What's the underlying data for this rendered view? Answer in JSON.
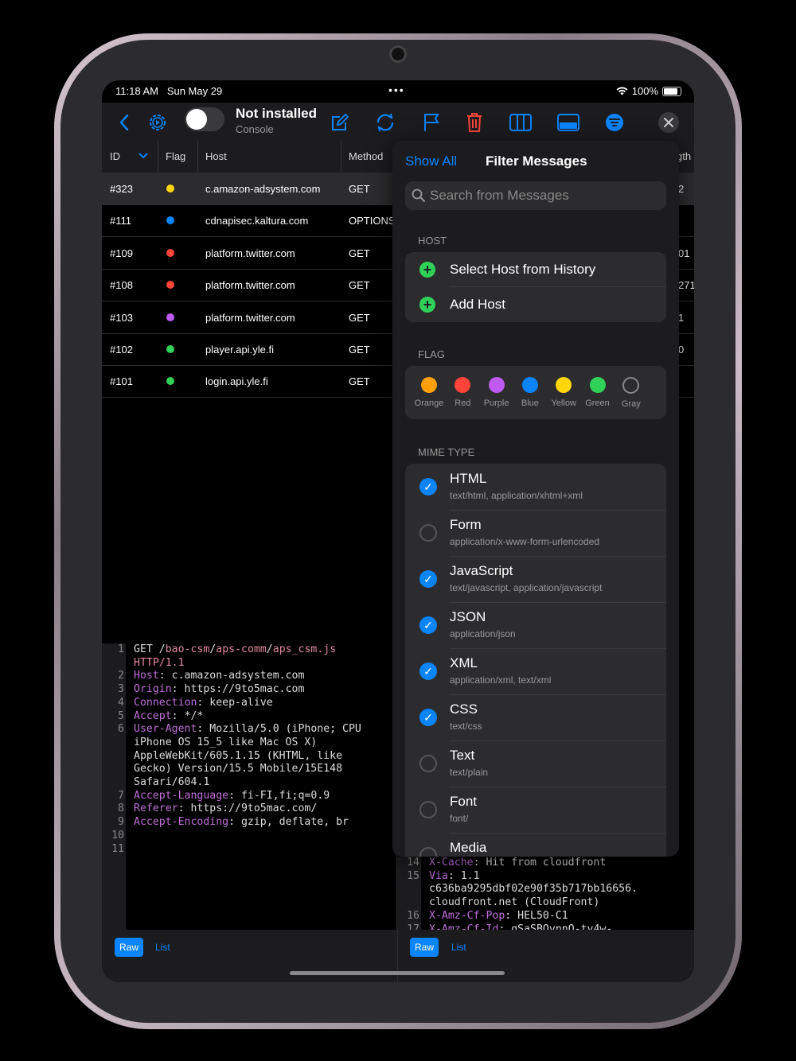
{
  "status": {
    "time": "11:18 AM",
    "date": "Sun May 29",
    "battery": "100%"
  },
  "toolbar": {
    "title": "Not installed",
    "subtitle": "Console"
  },
  "table": {
    "headers": {
      "id": "ID",
      "flag": "Flag",
      "host": "Host",
      "method": "Method",
      "length": "gth"
    },
    "rows": [
      {
        "id": "#323",
        "flag_color": "#ffd60a",
        "host": "c.amazon-adsystem.com",
        "method": "GET",
        "len": "2"
      },
      {
        "id": "#111",
        "flag_color": "#0a84ff",
        "host": "cdnapisec.kaltura.com",
        "method": "OPTIONS",
        "len": ""
      },
      {
        "id": "#109",
        "flag_color": "#ff453a",
        "host": "platform.twitter.com",
        "method": "GET",
        "len": "01"
      },
      {
        "id": "#108",
        "flag_color": "#ff453a",
        "host": "platform.twitter.com",
        "method": "GET",
        "len": "271"
      },
      {
        "id": "#103",
        "flag_color": "#bf5af2",
        "host": "platform.twitter.com",
        "method": "GET",
        "len": "1"
      },
      {
        "id": "#102",
        "flag_color": "#30d158",
        "host": "player.api.yle.fi",
        "method": "GET",
        "len": "0"
      },
      {
        "id": "#101",
        "flag_color": "#30d158",
        "host": "login.api.yle.fi",
        "method": "GET",
        "len": ""
      }
    ]
  },
  "request": {
    "line_numbers": [
      "1",
      "",
      "2",
      "3",
      "4",
      "5",
      "6",
      "",
      "",
      "",
      "",
      "7",
      "8",
      "9",
      "10",
      "11"
    ],
    "method": "GET",
    "path_parts": [
      "/",
      "bao-csm",
      "/",
      "aps-comm",
      "/",
      "aps_csm.js"
    ],
    "version": "HTTP/1.1",
    "headers": [
      {
        "k": "Host",
        "v": " c.amazon-adsystem.com"
      },
      {
        "k": "Origin",
        "v": " https://9to5mac.com"
      },
      {
        "k": "Connection",
        "v": " keep-alive"
      },
      {
        "k": "Accept",
        "v": " */*"
      },
      {
        "k": "User-Agent",
        "v": " Mozilla/5.0 (iPhone; CPU"
      },
      {
        "k": "",
        "v": "iPhone OS 15_5 like Mac OS X)"
      },
      {
        "k": "",
        "v": "AppleWebKit/605.1.15 (KHTML, like"
      },
      {
        "k": "",
        "v": "Gecko) Version/15.5 Mobile/15E148"
      },
      {
        "k": "",
        "v": "Safari/604.1"
      },
      {
        "k": "Accept-Language",
        "v": " fi-FI,fi;q=0.9"
      },
      {
        "k": "Referer",
        "v": " https://9to5mac.com/"
      },
      {
        "k": "Accept-Encoding",
        "v": " gzip, deflate, br"
      }
    ]
  },
  "response": {
    "line_numbers": [
      "14",
      "15",
      "",
      "",
      "16",
      "17"
    ],
    "lines": [
      {
        "k": "X-Cache",
        "v": " Hit from cloudfront"
      },
      {
        "k": "Via",
        "v": " 1.1"
      },
      {
        "k": "",
        "v": "c636ba9295dbf02e90f35b717bb16656."
      },
      {
        "k": "",
        "v": "cloudfront.net (CloudFront)"
      },
      {
        "k": "X-Amz-Cf-Pop",
        "v": " HEL50-C1"
      },
      {
        "k": "X-Amz-Cf-Id",
        "v": " gSaSBOvnnO-tv4w-"
      }
    ]
  },
  "footer": {
    "raw": "Raw",
    "list": "List"
  },
  "filter": {
    "show_all": "Show All",
    "title": "Filter Messages",
    "search_placeholder": "Search from Messages",
    "host_section": "HOST",
    "host_items": [
      "Select Host from History",
      "Add Host"
    ],
    "flag_section": "FLAG",
    "flags": [
      {
        "label": "Orange",
        "color": "#ff9f0a"
      },
      {
        "label": "Red",
        "color": "#ff453a"
      },
      {
        "label": "Purple",
        "color": "#bf5af2"
      },
      {
        "label": "Blue",
        "color": "#0a84ff"
      },
      {
        "label": "Yellow",
        "color": "#ffd60a"
      },
      {
        "label": "Green",
        "color": "#30d158"
      },
      {
        "label": "Gray",
        "color": "none"
      }
    ],
    "mime_section": "MIME TYPE",
    "mime_types": [
      {
        "name": "HTML",
        "desc": "text/html, application/xhtml+xml",
        "checked": true
      },
      {
        "name": "Form",
        "desc": "application/x-www-form-urlencoded",
        "checked": false
      },
      {
        "name": "JavaScript",
        "desc": "text/javascript, application/javascript",
        "checked": true
      },
      {
        "name": "JSON",
        "desc": "application/json",
        "checked": true
      },
      {
        "name": "XML",
        "desc": "application/xml, text/xml",
        "checked": true
      },
      {
        "name": "CSS",
        "desc": "text/css",
        "checked": true
      },
      {
        "name": "Text",
        "desc": "text/plain",
        "checked": false
      },
      {
        "name": "Font",
        "desc": "font/",
        "checked": false
      },
      {
        "name": "Media",
        "desc": "",
        "checked": false
      }
    ]
  }
}
